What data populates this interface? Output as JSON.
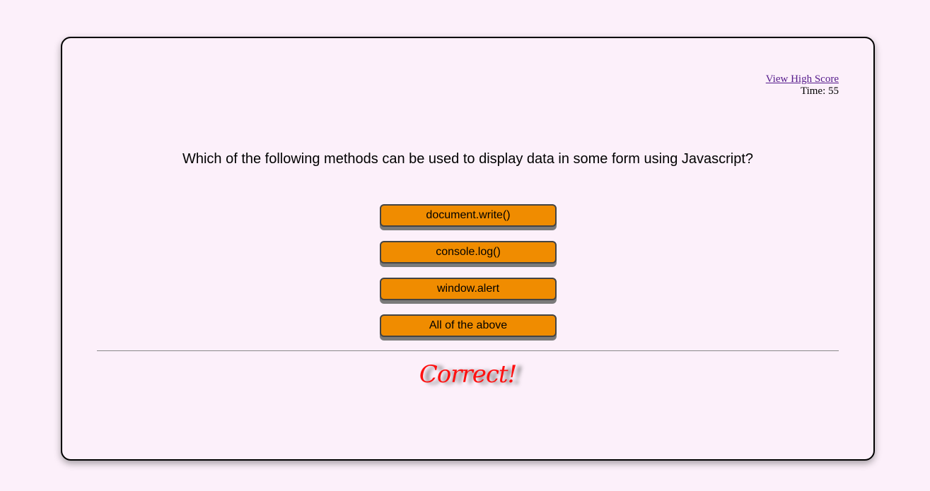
{
  "header": {
    "high_score_link": "View High Score",
    "time_label": "Time:",
    "time_value": "55"
  },
  "quiz": {
    "question": "Which of the following methods can be used to display data in some form using Javascript?",
    "answers": [
      {
        "label": "document.write()"
      },
      {
        "label": "console.log()"
      },
      {
        "label": "window.alert"
      },
      {
        "label": "All of the above"
      }
    ],
    "result": "Correct!"
  },
  "colors": {
    "background": "#fcf0fa",
    "answer_button": "#f08c00",
    "result_text": "#ff1010",
    "link": "#551a8b"
  }
}
